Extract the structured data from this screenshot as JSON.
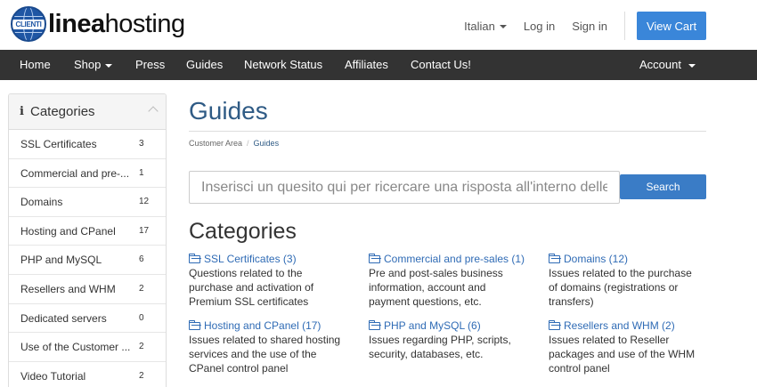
{
  "brand": {
    "logo_badge": "CLIENTI",
    "name_bold": "linea",
    "name_regular": "hosting"
  },
  "top_links": {
    "language": "Italian",
    "login": "Log in",
    "signin": "Sign in",
    "cart": "View Cart"
  },
  "nav": {
    "items": [
      "Home",
      "Shop",
      "Press",
      "Guides",
      "Network Status",
      "Affiliates",
      "Contact Us!"
    ],
    "account": "Account"
  },
  "sidebar": {
    "title": "Categories",
    "items": [
      {
        "label": "SSL Certificates",
        "count": "3"
      },
      {
        "label": "Commercial and pre-...",
        "count": "1"
      },
      {
        "label": "Domains",
        "count": "12"
      },
      {
        "label": "Hosting and CPanel",
        "count": "17"
      },
      {
        "label": "PHP and MySQL",
        "count": "6"
      },
      {
        "label": "Resellers and WHM",
        "count": "2"
      },
      {
        "label": "Dedicated servers",
        "count": "0"
      },
      {
        "label": "Use of the Customer ...",
        "count": "2"
      },
      {
        "label": "Video Tutorial",
        "count": "2"
      }
    ]
  },
  "main": {
    "title": "Guides",
    "breadcrumb": [
      "Customer Area",
      "Guides"
    ],
    "search_placeholder": "Inserisci un quesito qui per ricercare una risposta all'interno delle",
    "search_button": "Search",
    "categories_title": "Categories",
    "categories": [
      {
        "link": "SSL Certificates (3)",
        "lines": [
          "Questions related to the",
          "purchase and activation of",
          "Premium SSL certificates"
        ]
      },
      {
        "link": "Commercial and pre-sales (1)",
        "lines": [
          "Pre and post-sales business",
          "information, account and",
          "payment questions, etc."
        ]
      },
      {
        "link": "Domains (12)",
        "lines": [
          "Issues related to the purchase",
          "of domains (registrations or",
          "transfers)"
        ]
      },
      {
        "link": "Hosting and CPanel (17)",
        "lines": [
          "Issues related to shared hosting",
          "services and the use of the",
          "CPanel control panel"
        ]
      },
      {
        "link": "PHP and MySQL (6)",
        "lines": [
          "Issues regarding PHP, scripts,",
          "security, databases, etc."
        ]
      },
      {
        "link": "Resellers and WHM (2)",
        "lines": [
          "Issues related to Reseller",
          "packages and use of the WHM",
          "control panel"
        ]
      }
    ]
  },
  "colors": {
    "accent": "#3a86d9",
    "navbar": "#333333",
    "title": "#2f5b85",
    "link": "#2f6bb5"
  }
}
